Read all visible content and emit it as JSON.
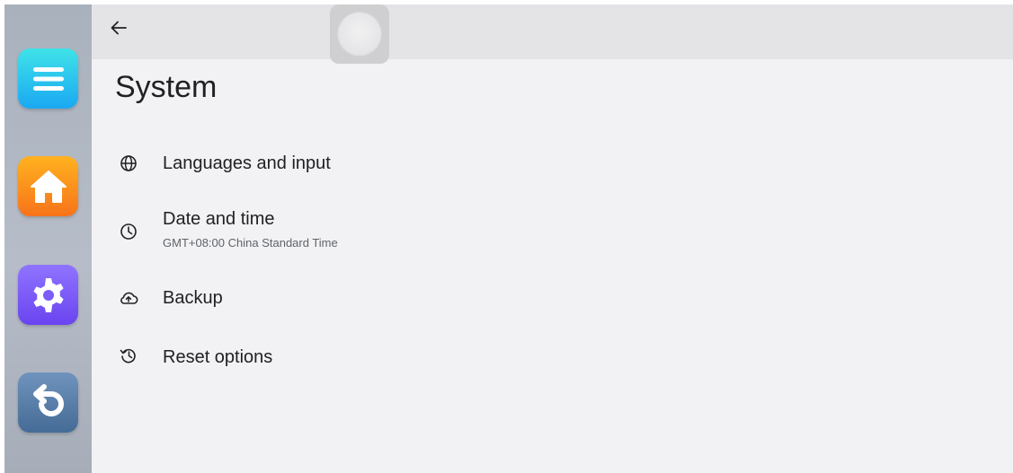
{
  "dock": {
    "items": [
      {
        "name": "menu",
        "icon": "menu-icon",
        "color": "#1aa8f2"
      },
      {
        "name": "home",
        "icon": "home-icon",
        "color": "#f7731a"
      },
      {
        "name": "settings",
        "icon": "gear-icon",
        "color": "#6a44f0"
      },
      {
        "name": "back",
        "icon": "undo-icon",
        "color": "#456c96"
      }
    ]
  },
  "header": {
    "back_icon": "arrow-left-icon"
  },
  "page": {
    "title": "System"
  },
  "settings": {
    "items": [
      {
        "label": "Languages and input",
        "icon": "globe-icon"
      },
      {
        "label": "Date and time",
        "summary": "GMT+08:00 China Standard Time",
        "icon": "clock-icon"
      },
      {
        "label": "Backup",
        "icon": "cloud-upload-icon"
      },
      {
        "label": "Reset options",
        "icon": "history-icon"
      }
    ]
  }
}
